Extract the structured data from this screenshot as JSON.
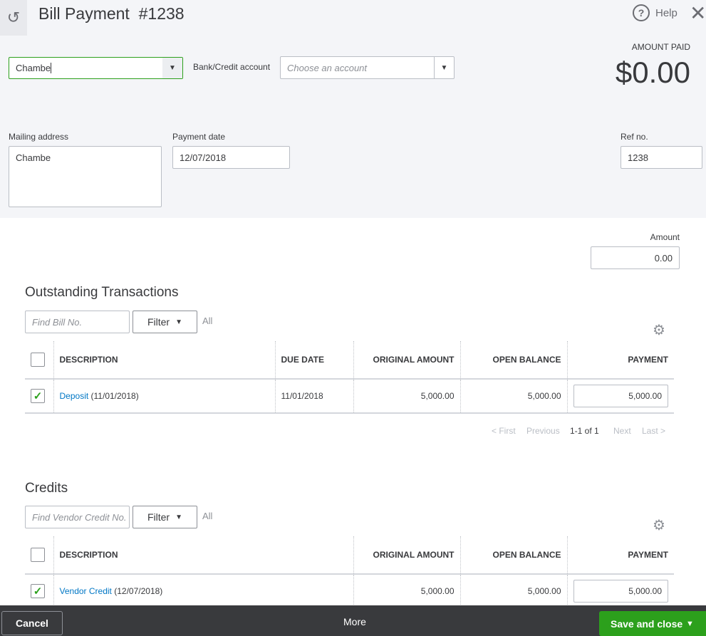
{
  "header": {
    "title": "Bill Payment",
    "number": "#1238",
    "help": "Help"
  },
  "payee": {
    "value": "Chambe"
  },
  "bank": {
    "label": "Bank/Credit account",
    "placeholder": "Choose an account"
  },
  "amount_paid": {
    "label": "AMOUNT PAID",
    "value": "$0.00"
  },
  "mailing": {
    "label": "Mailing address",
    "value": "Chambe"
  },
  "payment_date": {
    "label": "Payment date",
    "value": "12/07/2018"
  },
  "ref": {
    "label": "Ref no.",
    "value": "1238"
  },
  "amount": {
    "label": "Amount",
    "value": "0.00"
  },
  "outstanding": {
    "title": "Outstanding Transactions",
    "find_placeholder": "Find Bill No.",
    "filter": "Filter",
    "all": "All",
    "columns": [
      "DESCRIPTION",
      "DUE DATE",
      "ORIGINAL AMOUNT",
      "OPEN BALANCE",
      "PAYMENT"
    ],
    "rows": [
      {
        "link": "Deposit",
        "date_suffix": "(11/01/2018)",
        "due": "11/01/2018",
        "original": "5,000.00",
        "open": "5,000.00",
        "payment": "5,000.00",
        "checked": true
      }
    ],
    "pager": {
      "first": "< First",
      "previous": "Previous",
      "range": "1-1 of 1",
      "next": "Next",
      "last": "Last >"
    }
  },
  "credits": {
    "title": "Credits",
    "find_placeholder": "Find Vendor Credit No.",
    "filter": "Filter",
    "all": "All",
    "columns": [
      "DESCRIPTION",
      "ORIGINAL AMOUNT",
      "OPEN BALANCE",
      "PAYMENT"
    ],
    "rows": [
      {
        "link": "Vendor Credit",
        "date_suffix": "(12/07/2018)",
        "original": "5,000.00",
        "open": "5,000.00",
        "payment": "5,000.00",
        "checked": true
      }
    ]
  },
  "footer": {
    "cancel": "Cancel",
    "more": "More",
    "save": "Save and close"
  }
}
